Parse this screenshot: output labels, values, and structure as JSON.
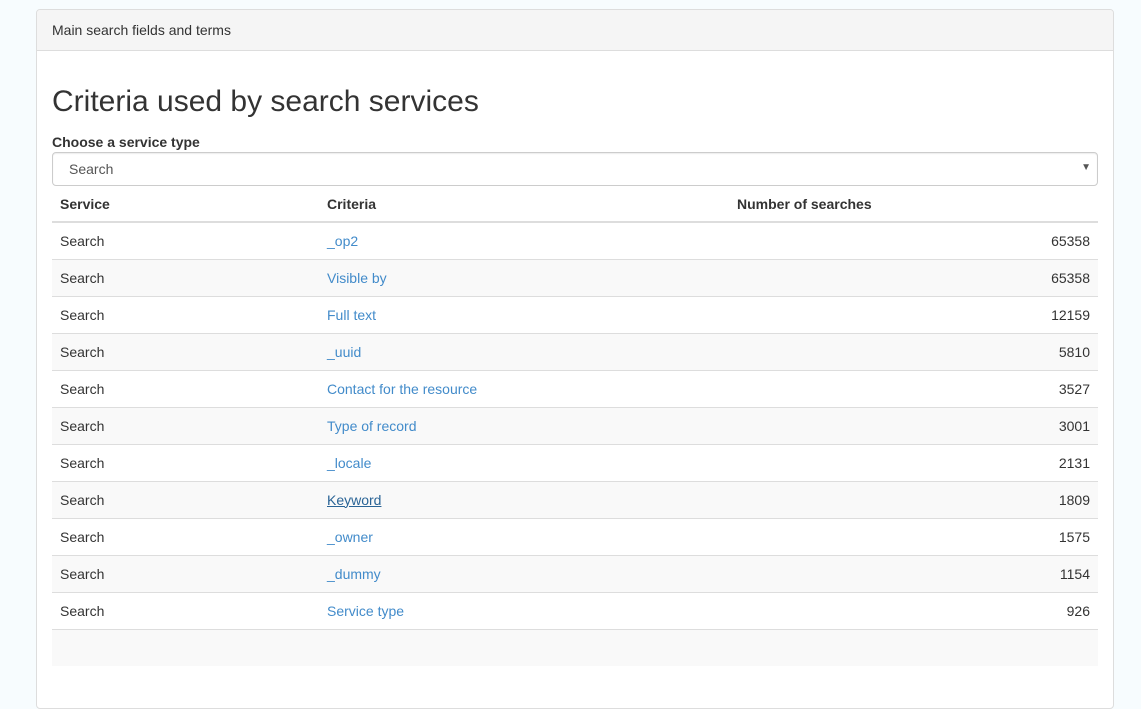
{
  "panel": {
    "heading": "Main search fields and terms"
  },
  "main": {
    "title": "Criteria used by search services",
    "service_type_label": "Choose a service type",
    "service_type_selected": "Search"
  },
  "table": {
    "headers": {
      "service": "Service",
      "criteria": "Criteria",
      "count": "Number of searches"
    },
    "rows": [
      {
        "service": "Search",
        "criteria": "_op2",
        "count": "65358"
      },
      {
        "service": "Search",
        "criteria": "Visible by",
        "count": "65358"
      },
      {
        "service": "Search",
        "criteria": "Full text",
        "count": "12159"
      },
      {
        "service": "Search",
        "criteria": "_uuid",
        "count": "5810"
      },
      {
        "service": "Search",
        "criteria": "Contact for the resource",
        "count": "3527"
      },
      {
        "service": "Search",
        "criteria": "Type of record",
        "count": "3001"
      },
      {
        "service": "Search",
        "criteria": "_locale",
        "count": "2131"
      },
      {
        "service": "Search",
        "criteria": "Keyword",
        "count": "1809"
      },
      {
        "service": "Search",
        "criteria": "_owner",
        "count": "1575"
      },
      {
        "service": "Search",
        "criteria": "_dummy",
        "count": "1154"
      },
      {
        "service": "Search",
        "criteria": "Service type",
        "count": "926"
      },
      {
        "service": "",
        "criteria": "",
        "count": ""
      }
    ]
  },
  "colors": {
    "link": "#428bca",
    "link_hover": "#2a6496",
    "page_bg": "#f7fcfe"
  }
}
